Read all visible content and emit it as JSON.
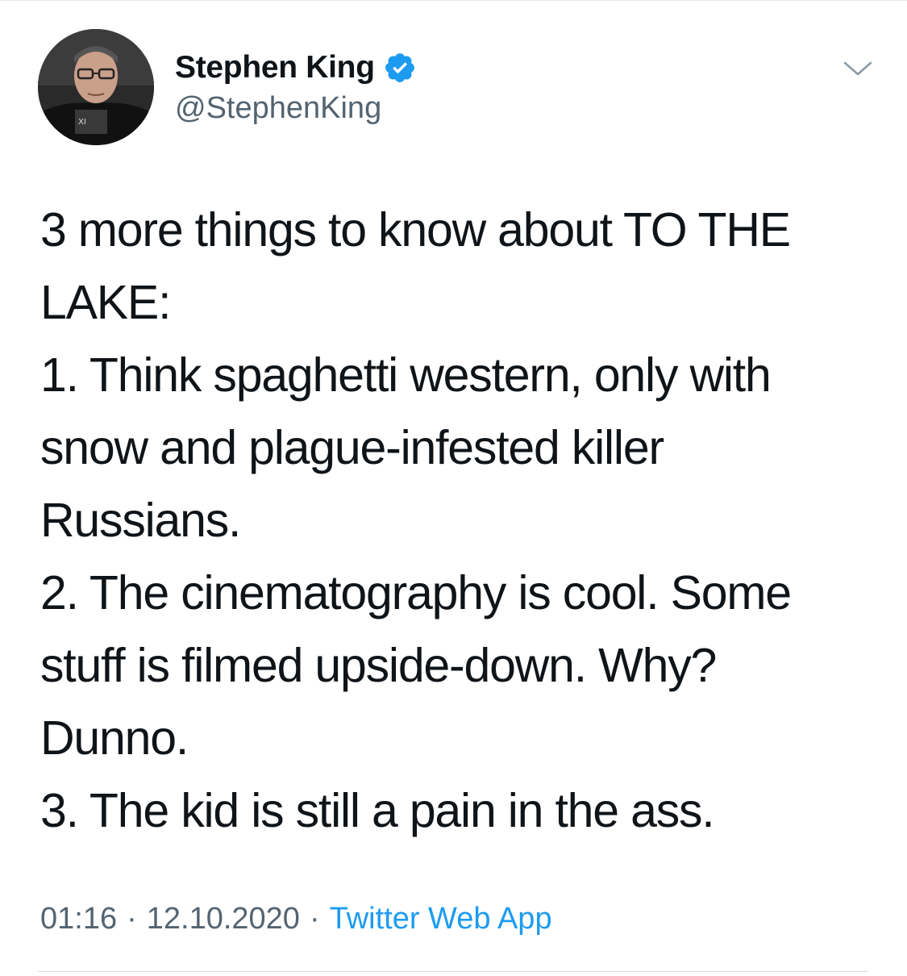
{
  "author": {
    "display_name": "Stephen King",
    "handle": "@StephenKing",
    "verified": true
  },
  "tweet": {
    "lines": [
      "3 more things to know about TO THE",
      "LAKE:",
      "1. Think spaghetti western, only with",
      "snow and plague-infested killer",
      "Russians.",
      "2. The cinematography is cool. Some",
      "stuff is filmed upside-down. Why?",
      "Dunno.",
      "3. The kid is still a pain in the ass."
    ]
  },
  "meta": {
    "time": "01:16",
    "date": "12.10.2020",
    "separator": "·",
    "source": "Twitter Web App"
  },
  "icons": {
    "verified": "verified-badge-icon",
    "more": "chevron-down-icon"
  },
  "colors": {
    "accent": "#1d9bf0",
    "text": "#0f1419",
    "secondary": "#536471"
  }
}
